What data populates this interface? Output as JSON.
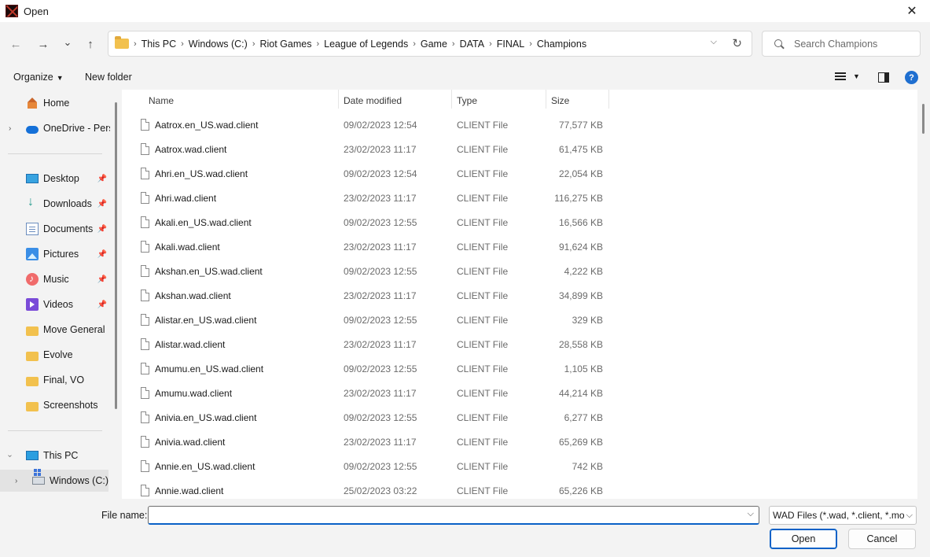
{
  "window": {
    "title": "Open",
    "close_glyph": "✕"
  },
  "nav": {
    "back_glyph": "←",
    "forward_glyph": "→",
    "recent_glyph": "⌄",
    "up_glyph": "↑",
    "breadcrumbs": [
      "This PC",
      "Windows (C:)",
      "Riot Games",
      "League of Legends",
      "Game",
      "DATA",
      "FINAL",
      "Champions"
    ],
    "search_placeholder": "Search Champions"
  },
  "toolbar": {
    "organize": "Organize",
    "new_folder": "New folder",
    "help": "?"
  },
  "sidebar": {
    "items": [
      {
        "label": "Home",
        "icon": "home-icon"
      },
      {
        "label": "OneDrive - Perso",
        "icon": "onedrive-icon"
      },
      {
        "label": "Desktop",
        "icon": "desktop-icon"
      },
      {
        "label": "Downloads",
        "icon": "downloads-icon"
      },
      {
        "label": "Documents",
        "icon": "documents-icon"
      },
      {
        "label": "Pictures",
        "icon": "pictures-icon"
      },
      {
        "label": "Music",
        "icon": "music-icon"
      },
      {
        "label": "Videos",
        "icon": "videos-icon"
      },
      {
        "label": "Move General",
        "icon": "folder-icon"
      },
      {
        "label": "Evolve",
        "icon": "folder-icon"
      },
      {
        "label": "Final, VO",
        "icon": "folder-icon"
      },
      {
        "label": "Screenshots",
        "icon": "folder-icon"
      },
      {
        "label": "This PC",
        "icon": "this-pc-icon"
      },
      {
        "label": "Windows (C:)",
        "icon": "drive-icon"
      }
    ]
  },
  "columns": {
    "name": "Name",
    "date": "Date modified",
    "type": "Type",
    "size": "Size"
  },
  "files": [
    {
      "name": "Aatrox.en_US.wad.client",
      "date": "09/02/2023 12:54",
      "type": "CLIENT File",
      "size": "77,577 KB"
    },
    {
      "name": "Aatrox.wad.client",
      "date": "23/02/2023 11:17",
      "type": "CLIENT File",
      "size": "61,475 KB"
    },
    {
      "name": "Ahri.en_US.wad.client",
      "date": "09/02/2023 12:54",
      "type": "CLIENT File",
      "size": "22,054 KB"
    },
    {
      "name": "Ahri.wad.client",
      "date": "23/02/2023 11:17",
      "type": "CLIENT File",
      "size": "116,275 KB"
    },
    {
      "name": "Akali.en_US.wad.client",
      "date": "09/02/2023 12:55",
      "type": "CLIENT File",
      "size": "16,566 KB"
    },
    {
      "name": "Akali.wad.client",
      "date": "23/02/2023 11:17",
      "type": "CLIENT File",
      "size": "91,624 KB"
    },
    {
      "name": "Akshan.en_US.wad.client",
      "date": "09/02/2023 12:55",
      "type": "CLIENT File",
      "size": "4,222 KB"
    },
    {
      "name": "Akshan.wad.client",
      "date": "23/02/2023 11:17",
      "type": "CLIENT File",
      "size": "34,899 KB"
    },
    {
      "name": "Alistar.en_US.wad.client",
      "date": "09/02/2023 12:55",
      "type": "CLIENT File",
      "size": "329 KB"
    },
    {
      "name": "Alistar.wad.client",
      "date": "23/02/2023 11:17",
      "type": "CLIENT File",
      "size": "28,558 KB"
    },
    {
      "name": "Amumu.en_US.wad.client",
      "date": "09/02/2023 12:55",
      "type": "CLIENT File",
      "size": "1,105 KB"
    },
    {
      "name": "Amumu.wad.client",
      "date": "23/02/2023 11:17",
      "type": "CLIENT File",
      "size": "44,214 KB"
    },
    {
      "name": "Anivia.en_US.wad.client",
      "date": "09/02/2023 12:55",
      "type": "CLIENT File",
      "size": "6,277 KB"
    },
    {
      "name": "Anivia.wad.client",
      "date": "23/02/2023 11:17",
      "type": "CLIENT File",
      "size": "65,269 KB"
    },
    {
      "name": "Annie.en_US.wad.client",
      "date": "09/02/2023 12:55",
      "type": "CLIENT File",
      "size": "742 KB"
    },
    {
      "name": "Annie.wad.client",
      "date": "25/02/2023 03:22",
      "type": "CLIENT File",
      "size": "65,226 KB"
    }
  ],
  "footer": {
    "file_name_label": "File name:",
    "file_name_value": "",
    "file_type": "WAD Files (*.wad, *.client, *.mo",
    "open": "Open",
    "cancel": "Cancel"
  },
  "colors": {
    "accent": "#0a61c7",
    "folder": "#f2c14e"
  }
}
